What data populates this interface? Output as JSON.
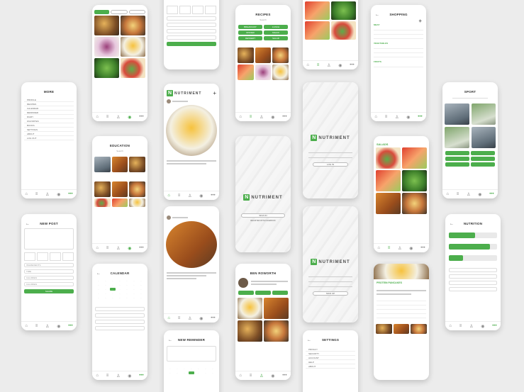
{
  "brand": {
    "name": "NUTRIMENT",
    "accent": "#4cae4c"
  },
  "screens": {
    "more": {
      "title": "MORE",
      "items": [
        "PROFILE",
        "RECIPES",
        "CALENDAR",
        "REMINDER",
        "DIARY",
        "FAVORITES",
        "BOOKS",
        "SETTINGS",
        "ABOUT",
        "LOG OUT"
      ]
    },
    "newpost": {
      "title": "NEW POST",
      "fields": [
        "INGREDIENTS",
        "TIME",
        "CALORIES",
        "CALORIES"
      ],
      "button": "SHARE"
    },
    "education": {
      "title": "EDUCATION",
      "search": "Search"
    },
    "calendar": {
      "title": "CALENDAR"
    },
    "feed": {
      "logo": "NUTRIMENT"
    },
    "login": {
      "logo": "NUTRIMENT",
      "buttons": [
        "SIGN IN",
        "REGISTER WITH FACEBOOK"
      ]
    },
    "reminder": {
      "title": "NEW REMINDER"
    },
    "recipes": {
      "title": "RECIPES",
      "search": "Search",
      "filters": [
        "BREAKFAST",
        "LUNCH",
        "DINNER",
        "SNACK",
        "DESSERT",
        "SALAD"
      ]
    },
    "profile": {
      "name": "BEN ROWORTH"
    },
    "signin": {
      "logo": "NUTRIMENT",
      "button": "LOG IN"
    },
    "signup": {
      "logo": "NUTRIMENT",
      "button": "SIGN UP"
    },
    "settings": {
      "title": "SETTINGS",
      "items": [
        "PRIVACY",
        "SECURITY",
        "ACCOUNT",
        "HELP",
        "ABOUT"
      ]
    },
    "shopping": {
      "title": "SHOPPING",
      "sections": [
        "MEAT",
        "VEGETABLES",
        "FRUITS"
      ]
    },
    "salads": {
      "title": "SALADS"
    },
    "pancakes": {
      "title": "PROTEIN PANCAKES"
    },
    "sport": {
      "title": "SPORT"
    },
    "nutrition": {
      "title": "NUTRITION",
      "bars": [
        0.55,
        0.85,
        0.3
      ]
    }
  }
}
